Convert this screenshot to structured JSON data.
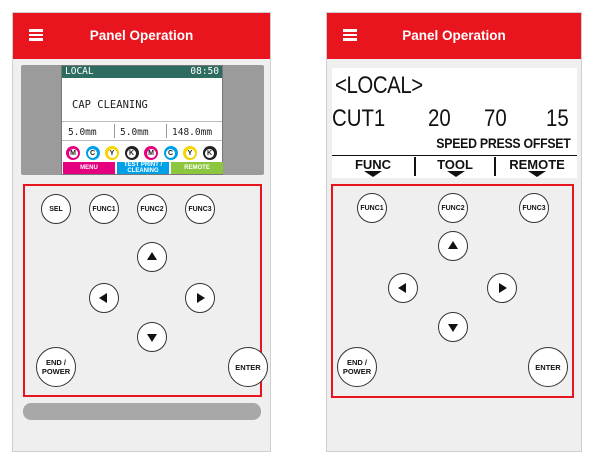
{
  "colors": {
    "header": "#e8141e",
    "lcd_bar": "#2e6b60",
    "highlight_border": "#e8141e"
  },
  "icons": {
    "menu": "hamburger-list-icon",
    "up": "arrow-up-icon",
    "down": "arrow-down-icon",
    "left": "arrow-left-icon",
    "right": "arrow-right-icon"
  },
  "panel1": {
    "header_title": "Panel Operation",
    "lcd": {
      "mode": "LOCAL",
      "time": "08:50",
      "message": "CAP CLEANING",
      "values": [
        "5.0mm",
        "5.0mm",
        "148.0mm"
      ],
      "inks": [
        {
          "letter": "M",
          "color": "#e4007f"
        },
        {
          "letter": "C",
          "color": "#00a0e9"
        },
        {
          "letter": "Y",
          "color": "#f5d500"
        },
        {
          "letter": "K",
          "color": "#222222"
        },
        {
          "letter": "M",
          "color": "#e4007f"
        },
        {
          "letter": "C",
          "color": "#00a0e9"
        },
        {
          "letter": "Y",
          "color": "#f5d500"
        },
        {
          "letter": "K",
          "color": "#222222"
        }
      ],
      "fn_labels": [
        {
          "text": "MENU",
          "color": "#e4007f"
        },
        {
          "text": "TEST PRINT / CLEANING",
          "color": "#00a0e9"
        },
        {
          "text": "REMOTE",
          "color": "#8cc63f"
        }
      ]
    },
    "buttons": {
      "sel": "SEL",
      "func1": "FUNC1",
      "func2": "FUNC2",
      "func3": "FUNC3",
      "end_power": "END / POWER",
      "enter": "ENTER"
    }
  },
  "panel2": {
    "header_title": "Panel Operation",
    "lcd": {
      "title": "<LOCAL>",
      "line2": [
        "CUT1",
        "20",
        "70",
        "15"
      ],
      "labels": "SPEED PRESS OFFSET",
      "fn_labels": [
        "FUNC",
        "TOOL",
        "REMOTE"
      ]
    },
    "buttons": {
      "func1": "FUNC1",
      "func2": "FUNC2",
      "func3": "FUNC3",
      "end_power": "END / POWER",
      "enter": "ENTER"
    }
  }
}
